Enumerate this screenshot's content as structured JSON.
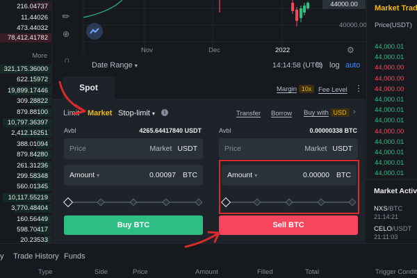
{
  "orderbook": {
    "top_rows": [
      "216.04737",
      "11.44026",
      "473.44032",
      "78,412.41782"
    ],
    "more_label": "More",
    "rows": [
      "321,175.36000",
      "622.15972",
      "19,899.17446",
      "309.28822",
      "879.88100",
      "10,797.36397",
      "2,412.16251",
      "388.01094",
      "879.84280",
      "261.31236",
      "299.58348",
      "560.01345",
      "10,117.55219",
      "3,770.48404",
      "160.56449",
      "598.70417",
      "20.23533"
    ]
  },
  "chart": {
    "price_current": "44000.00",
    "price_level": "40000.00",
    "x_labels": [
      "Nov",
      "Dec",
      "2022"
    ],
    "date_range": "Date Range",
    "time": "14:14:58 (UTC)",
    "percent": "%",
    "log": "log",
    "auto": "auto"
  },
  "market_trades": {
    "title": "Market Trade",
    "price_header": "Price(USDT)",
    "prices": [
      {
        "v": "44,000.01",
        "c": "#2ebd85"
      },
      {
        "v": "44,000.01",
        "c": "#2ebd85"
      },
      {
        "v": "44,000.00",
        "c": "#f6465d"
      },
      {
        "v": "44,000.00",
        "c": "#f6465d"
      },
      {
        "v": "44,000.00",
        "c": "#f6465d"
      },
      {
        "v": "44,000.01",
        "c": "#2ebd85"
      },
      {
        "v": "44,000.01",
        "c": "#2ebd85"
      },
      {
        "v": "44,000.01",
        "c": "#2ebd85"
      },
      {
        "v": "44,000.00",
        "c": "#f6465d"
      },
      {
        "v": "44,000.01",
        "c": "#2ebd85"
      },
      {
        "v": "44,000.01",
        "c": "#2ebd85"
      },
      {
        "v": "44,000.01",
        "c": "#2ebd85"
      },
      {
        "v": "44,000.01",
        "c": "#2ebd85"
      },
      {
        "v": "44,000.00",
        "c": "#f6465d"
      },
      {
        "v": "44,000.01",
        "c": "#2ebd85"
      }
    ]
  },
  "market_activities": {
    "title": "Market Activi",
    "items": [
      {
        "pair_base": "NXS",
        "pair_quote": "/BTC",
        "time": "21:14:21"
      },
      {
        "pair_base": "CELO",
        "pair_quote": "/USDT",
        "time": "21:11:03"
      }
    ]
  },
  "panel": {
    "spot_tab": "Spot",
    "margin_label": "Margin",
    "margin_badge": "10x",
    "fee_level": "Fee Level",
    "order_types": {
      "limit": "Limit",
      "market": "Market",
      "stop_limit": "Stop-limit"
    },
    "transfer": "Transfer",
    "borrow": "Borrow",
    "buy_with": "Buy with",
    "buy_with_badge": "USD",
    "buy": {
      "avbl_label": "Avbl",
      "avbl_value": "4265.64417840 USDT",
      "price_label": "Price",
      "price_value": "Market",
      "price_unit": "USDT",
      "amount_label": "Amount",
      "amount_value": "0.00097",
      "amount_unit": "BTC",
      "button": "Buy BTC"
    },
    "sell": {
      "avbl_label": "Avbl",
      "avbl_value": "0.00000338 BTC",
      "price_label": "Price",
      "price_value": "Market",
      "price_unit": "USDT",
      "amount_label": "Amount",
      "amount_value": "0.00000",
      "amount_unit": "BTC",
      "button": "Sell BTC"
    }
  },
  "bottom": {
    "tabs": [
      "y",
      "Trade History",
      "Funds"
    ],
    "columns": [
      "Type",
      "Side",
      "Price",
      "Amount",
      "Filled",
      "Total",
      "Trigger Condition"
    ]
  },
  "colors": {
    "buy": "#2ebd85",
    "sell": "#f6465d",
    "accent": "#f0b90b",
    "annotation": "#d92b2b"
  }
}
